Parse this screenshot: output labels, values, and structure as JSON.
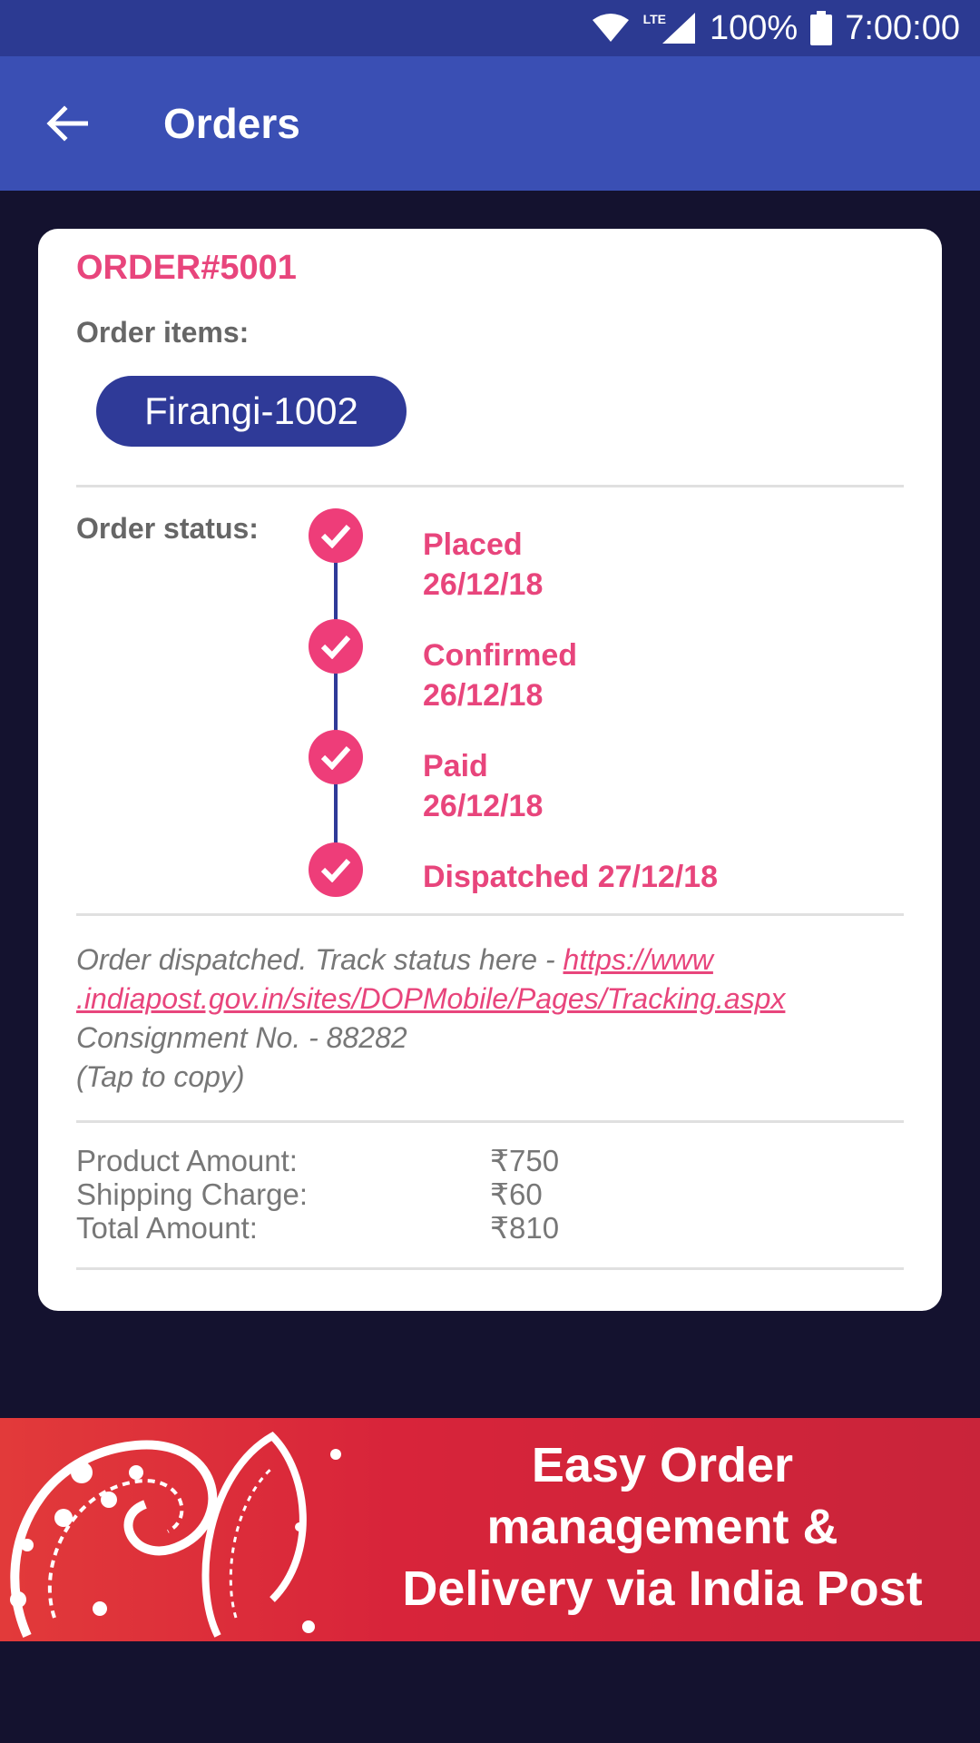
{
  "status_bar": {
    "network_label": "LTE",
    "battery": "100%",
    "time": "7:00:00"
  },
  "app_bar": {
    "back_icon": "arrow-left-icon",
    "title": "Orders"
  },
  "order": {
    "id": "ORDER#5001",
    "items_label": "Order items:",
    "items": [
      "Firangi-1002"
    ],
    "status_label": "Order status:",
    "steps": [
      {
        "name": "Placed",
        "date": "26/12/18"
      },
      {
        "name": "Confirmed",
        "date": "26/12/18"
      },
      {
        "name": "Paid",
        "date": "26/12/18"
      },
      {
        "name": "Dispatched",
        "date": "27/12/18"
      }
    ],
    "step_icon": "check-circle-icon",
    "dispatch_message": "Order dispatched. Track status here - ",
    "tracking_url_line1": "https://www",
    "tracking_url_line2": ".indiapost.gov.in/sites/DOPMobile/Pages/Tracking.aspx",
    "consignment": "Consignment No. - 88282",
    "tap_to_copy": "(Tap to copy)",
    "amounts": [
      {
        "label": "Product Amount:",
        "value": "₹750"
      },
      {
        "label": "Shipping Charge:",
        "value": "₹60"
      },
      {
        "label": "Total Amount:",
        "value": "₹810"
      }
    ]
  },
  "banner": {
    "line1": "Easy Order",
    "line2": "management &",
    "line3": "Delivery via India Post"
  },
  "colors": {
    "app_bar": "#3a4fb4",
    "status_bar": "#2c3a92",
    "accent_pink": "#e8457c",
    "chip": "#2f3a98",
    "background": "#14122f"
  }
}
